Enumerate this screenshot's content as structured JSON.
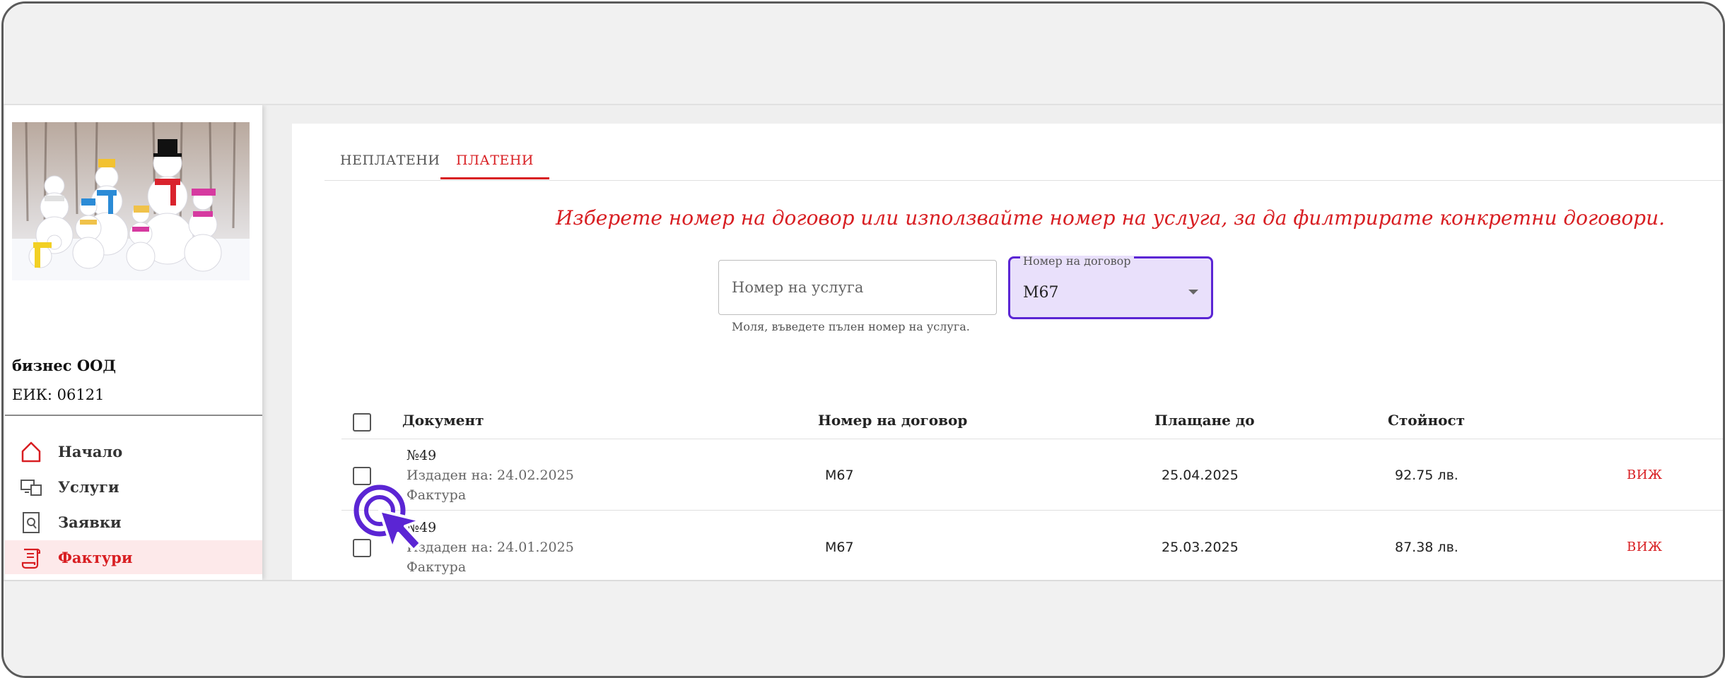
{
  "sidebar": {
    "company_name": "бизнес ООД",
    "eik": "ЕИК: 06121",
    "items": [
      {
        "label": "Начало",
        "icon": "home-icon"
      },
      {
        "label": "Услуги",
        "icon": "services-icon"
      },
      {
        "label": "Заявки",
        "icon": "requests-icon"
      },
      {
        "label": "Фактури",
        "icon": "invoices-icon",
        "active": true
      }
    ]
  },
  "tabs": [
    {
      "label": "НЕПЛАТЕНИ"
    },
    {
      "label": "ПЛАТЕНИ",
      "active": true
    }
  ],
  "filter": {
    "hint": "Изберете номер на договор или използвайте номер на услуга, за да филтрирате конкретни договори.",
    "service_placeholder": "Номер на услуга",
    "service_helper": "Моля, въведете пълен номер на услуга.",
    "contract_label": "Номер на договор",
    "contract_value": "M67"
  },
  "table": {
    "headers": [
      "Документ",
      "Номер на договор",
      "Плащане до",
      "Стойност"
    ],
    "rows": [
      {
        "number": "№49",
        "issued": "Издаден на: 24.02.2025",
        "type": "Фактура",
        "contract": "M67",
        "due": "25.04.2025",
        "amount": "92.75 лв.",
        "action": "ВИЖ"
      },
      {
        "number": "№49",
        "issued": "Издаден на: 24.01.2025",
        "type": "Фактура",
        "contract": "M67",
        "due": "25.03.2025",
        "amount": "87.38 лв.",
        "action": "ВИЖ"
      }
    ]
  },
  "colors": {
    "accent": "#d81e22",
    "focus": "#5b25d4",
    "focus_bg": "#e9e0fb"
  }
}
